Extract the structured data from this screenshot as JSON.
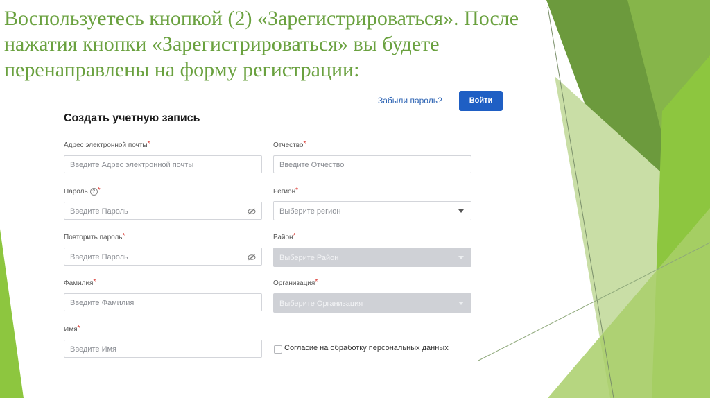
{
  "slide": {
    "text": "Воспользуетесь кнопкой (2) «Зарегистрироваться». После нажатия кнопки «Зарегистрироваться» вы будете перенаправлены на форму регистрации:"
  },
  "colors": {
    "slide_text": "#6aa13f",
    "accent_green": "#8dc63f",
    "button_blue": "#1f5fc4",
    "link_blue": "#2c63b3",
    "required_red": "#d9322b"
  },
  "header": {
    "forgot_password": "Забыли пароль?",
    "login_button": "Войти"
  },
  "form": {
    "title": "Создать учетную запись",
    "required_mark": "*",
    "help_icon_glyph": "?",
    "left": {
      "email": {
        "label": "Адрес электронной почты",
        "placeholder": "Введите Адрес электронной почты"
      },
      "password": {
        "label": "Пароль",
        "placeholder": "Введите Пароль",
        "icon": "eye-off-icon"
      },
      "password_repeat": {
        "label": "Повторить пароль",
        "placeholder": "Введите Пароль",
        "icon": "eye-off-icon"
      },
      "last_name": {
        "label": "Фамилия",
        "placeholder": "Введите Фамилия"
      },
      "first_name": {
        "label": "Имя",
        "placeholder": "Введите Имя"
      }
    },
    "right": {
      "middle_name": {
        "label": "Отчество",
        "placeholder": "Введите Отчество"
      },
      "region": {
        "label": "Регион",
        "placeholder": "Выберите регион",
        "disabled": false
      },
      "district": {
        "label": "Район",
        "placeholder": "Выберите Район",
        "disabled": true
      },
      "organization": {
        "label": "Организация",
        "placeholder": "Выберите Организация",
        "disabled": true
      }
    },
    "consent": {
      "label": "Согласие на обработку персональных данных",
      "checked": false
    }
  }
}
